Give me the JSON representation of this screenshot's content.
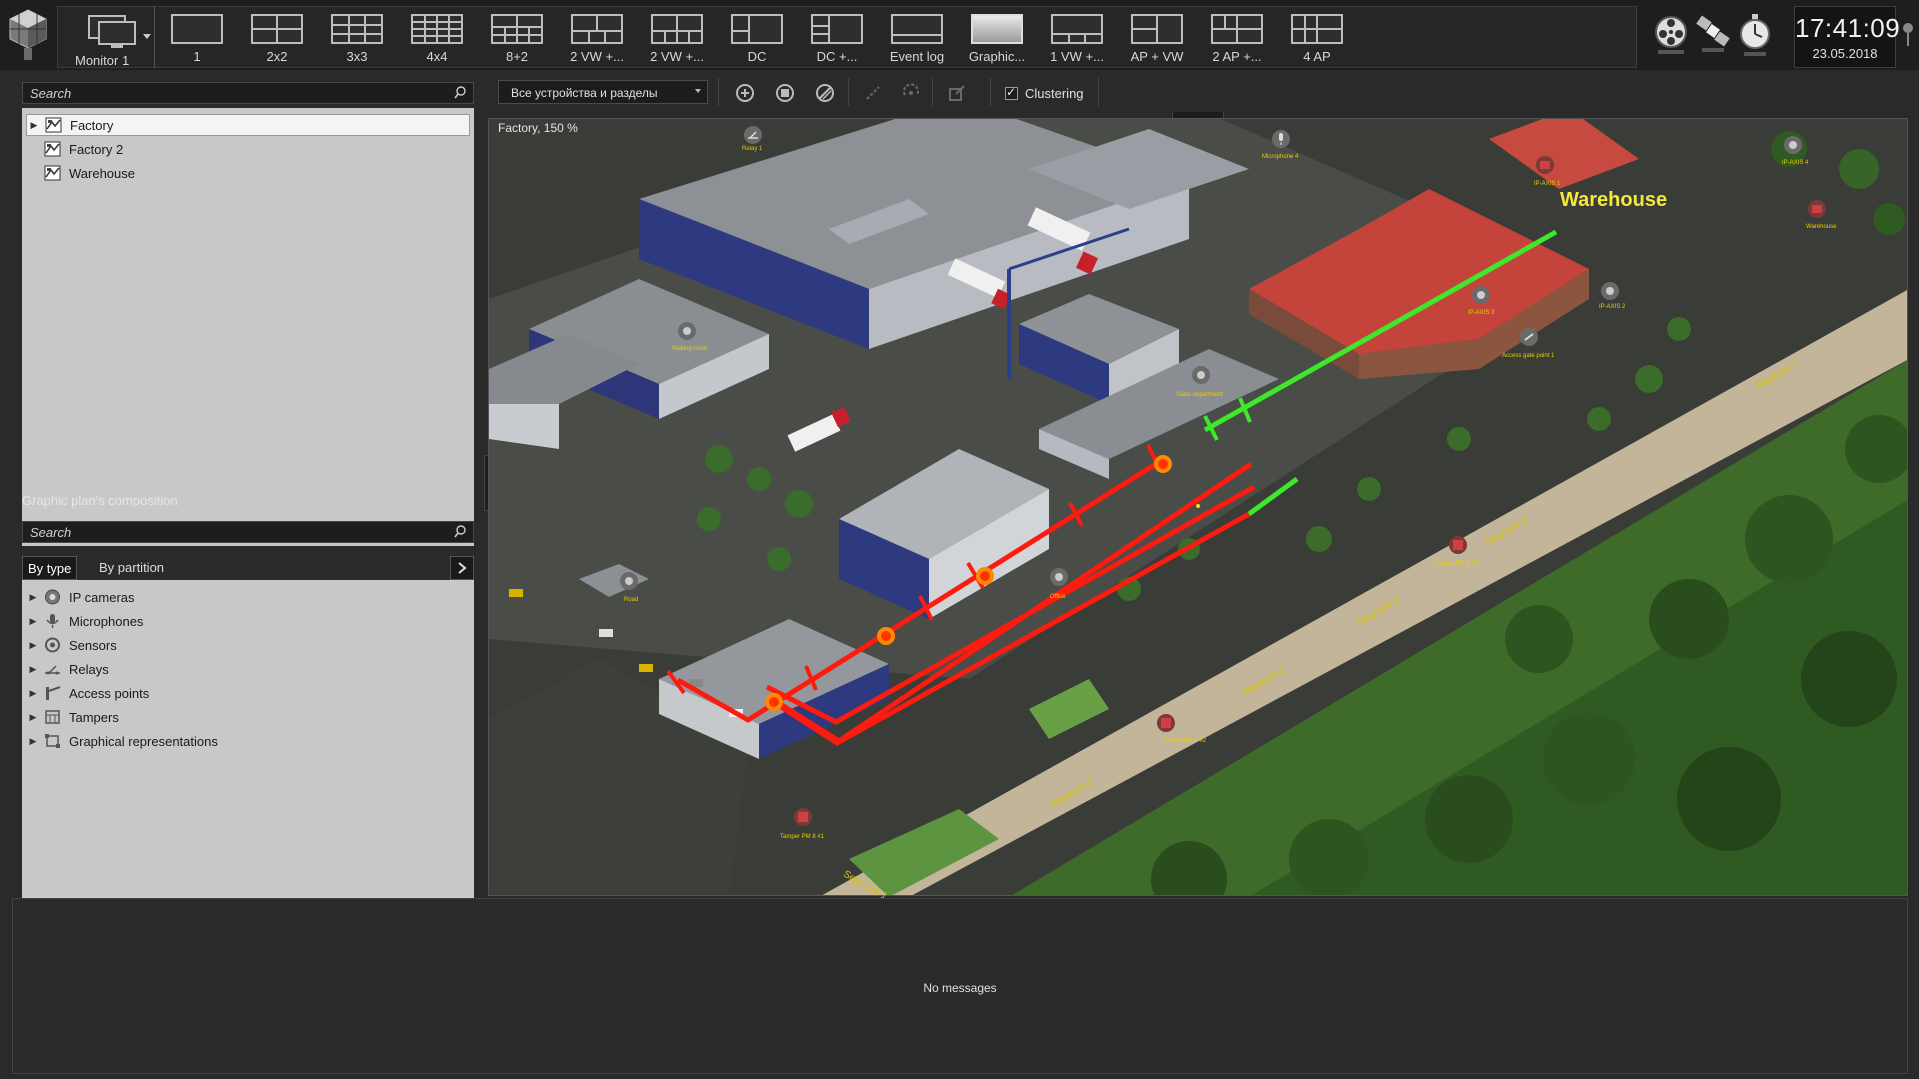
{
  "toolbar": {
    "monitor_label": "Monitor 1",
    "layouts": [
      {
        "label": "1"
      },
      {
        "label": "2x2"
      },
      {
        "label": "3x3"
      },
      {
        "label": "4x4"
      },
      {
        "label": "8+2"
      },
      {
        "label": "2 VW +..."
      },
      {
        "label": "2 VW +..."
      },
      {
        "label": "DC"
      },
      {
        "label": "DC +..."
      },
      {
        "label": "Event log"
      },
      {
        "label": "Graphic..."
      },
      {
        "label": "1 VW +..."
      },
      {
        "label": "AP + VW"
      },
      {
        "label": "2 AP +..."
      },
      {
        "label": "4 AP"
      }
    ],
    "system_icons": [
      "film-reel-icon",
      "satellite-icon",
      "stopwatch-icon"
    ],
    "clock_time": "17:41:09",
    "clock_date": "23.05.2018"
  },
  "left": {
    "search_placeholder": "Search",
    "maps": [
      {
        "label": "Factory",
        "selected": true
      },
      {
        "label": "Factory 2"
      },
      {
        "label": "Warehouse"
      }
    ],
    "composition_title": "Graphic plan's composition",
    "composition_search_placeholder": "Search",
    "tab_by_type": "By type",
    "tab_by_partition": "By partition",
    "categories": [
      {
        "label": "IP cameras",
        "icon": "camera-icon"
      },
      {
        "label": "Microphones",
        "icon": "microphone-icon"
      },
      {
        "label": "Sensors",
        "icon": "sensor-icon"
      },
      {
        "label": "Relays",
        "icon": "relay-icon"
      },
      {
        "label": "Access points",
        "icon": "access-point-icon"
      },
      {
        "label": "Tampers",
        "icon": "tamper-icon"
      },
      {
        "label": "Graphical representations",
        "icon": "graphic-rep-icon"
      }
    ]
  },
  "map_toolbar": {
    "device_filter": "Все устройства и разделы",
    "clustering_label": "Clustering",
    "clustering_checked": true
  },
  "map": {
    "caption": "Factory, 150 %",
    "warehouse_label": "Warehouse",
    "markers": [
      {
        "label": "Relay 1"
      },
      {
        "label": "Microphone 4"
      },
      {
        "label": "IP-AXIS 1"
      },
      {
        "label": "IP-AXIS 4"
      },
      {
        "label": "Warehouse"
      },
      {
        "label": "Waiting room"
      },
      {
        "label": "IP-AXIS 3"
      },
      {
        "label": "IP-AXIS 2"
      },
      {
        "label": "Access gate point 1"
      },
      {
        "label": "Sales department"
      },
      {
        "label": "Tamper PM 8 #1"
      },
      {
        "label": "Tamper PM 8 #2"
      },
      {
        "label": "Tamper PM 8 #3"
      },
      {
        "label": "Road"
      },
      {
        "label": "Office"
      }
    ],
    "segments": [
      "Segment 1",
      "Segment 5",
      "Segment 2",
      "Segment 6",
      "Segment 3",
      "Segment 7"
    ]
  },
  "messages": {
    "empty_text": "No messages"
  }
}
